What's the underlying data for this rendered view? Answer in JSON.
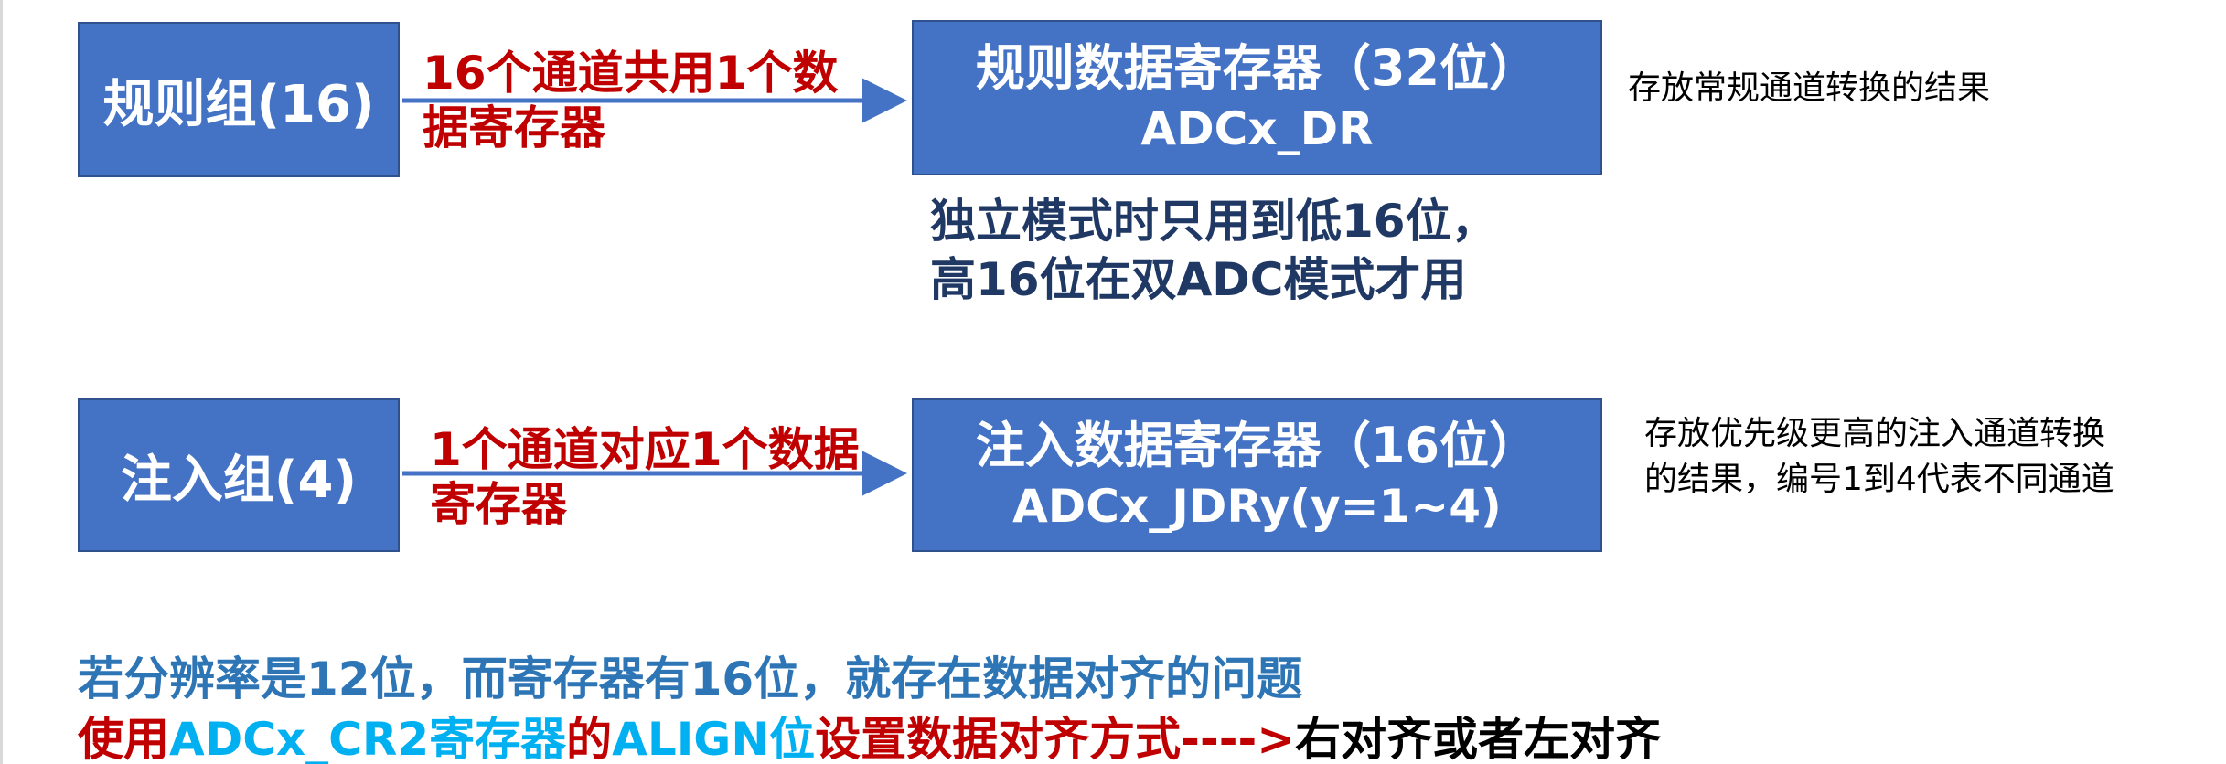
{
  "colors": {
    "box_fill": "#4472c4",
    "box_border": "#2f528f",
    "arrow": "#4472c4",
    "label_red": "#c00000",
    "note_dark_blue": "#1f3864",
    "text_blue": "#2e75b6",
    "text_cyan": "#00b0f0"
  },
  "row1": {
    "group_label": "规则组(16)",
    "arrow_label_line1": "16个通道共用1个数",
    "arrow_label_line2": "据寄存器",
    "register_title": "规则数据寄存器（32位）",
    "register_name": "ADCx_DR",
    "side_note": "存放常规通道转换的结果",
    "blue_note_line1": "独立模式时只用到低16位，",
    "blue_note_line2": "高16位在双ADC模式才用"
  },
  "row2": {
    "group_label": "注入组(4)",
    "arrow_label_line1": "1个通道对应1个数据",
    "arrow_label_line2": "寄存器",
    "register_title": "注入数据寄存器（16位）",
    "register_name": "ADCx_JDRy(y=1~4)",
    "side_note_line1": "存放优先级更高的注入通道转换",
    "side_note_line2": "的结果，编号1到4代表不同通道"
  },
  "bottom": {
    "line1": "若分辨率是12位，而寄存器有16位，就存在数据对齐的问题",
    "line2_part1": "使用",
    "line2_part2": "ADCx_CR2寄存器",
    "line2_part3": "的",
    "line2_part4": "ALIGN位",
    "line2_part5": "设置数据对齐方式---->",
    "line2_part6": "右对齐或者左对齐"
  }
}
